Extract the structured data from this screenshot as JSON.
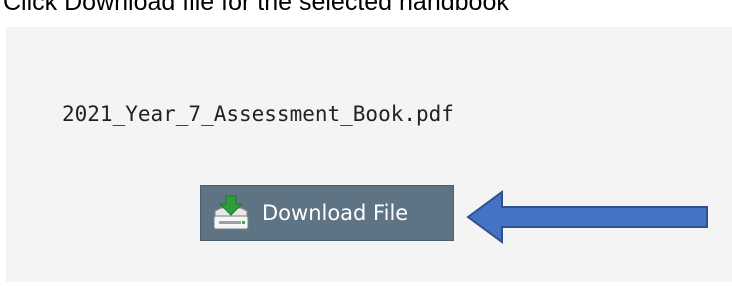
{
  "instruction": {
    "text": "Click Download file for the selected handbook"
  },
  "file": {
    "name": "2021_Year_7_Assessment_Book.pdf"
  },
  "download": {
    "label": "Download File",
    "icon": "download-tray-icon"
  },
  "annotation": {
    "arrow_icon": "left-arrow-icon",
    "arrow_color": "#4472c4",
    "arrow_border_color": "#2f528f"
  },
  "colors": {
    "panel_background": "#f4f4f4",
    "button_background": "#5e7485",
    "button_text": "#ffffff",
    "icon_green": "#2e9e3a"
  }
}
